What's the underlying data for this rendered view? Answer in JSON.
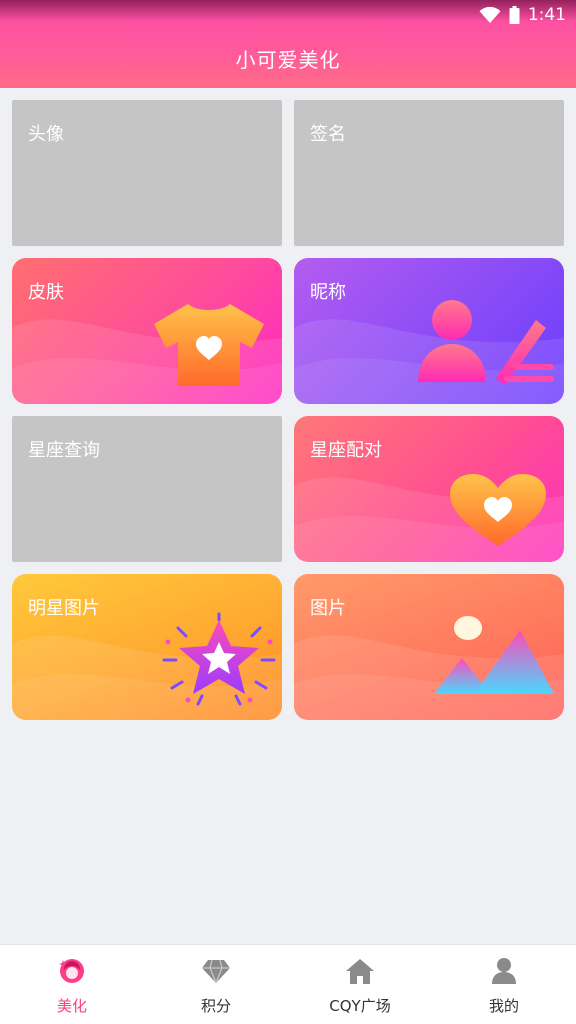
{
  "status_bar": {
    "time": "1:41",
    "wifi_icon": "wifi-icon",
    "battery_icon": "battery-icon"
  },
  "header": {
    "title": "小可爱美化"
  },
  "cards": [
    {
      "label": "头像",
      "style": "flat",
      "icon": null
    },
    {
      "label": "签名",
      "style": "flat",
      "icon": null
    },
    {
      "label": "皮肤",
      "style": "gradient",
      "colors": [
        "#ff6f6f",
        "#ff26c4"
      ],
      "icon": "tshirt-heart-icon"
    },
    {
      "label": "昵称",
      "style": "gradient",
      "colors": [
        "#b45cf0",
        "#6c3cff"
      ],
      "icon": "user-pen-icon"
    },
    {
      "label": "星座查询",
      "style": "flat",
      "icon": null
    },
    {
      "label": "星座配对",
      "style": "gradient",
      "colors": [
        "#ff7878",
        "#ff2fbf"
      ],
      "icon": "heart-icon"
    },
    {
      "label": "明星图片",
      "style": "gradient",
      "colors": [
        "#ffc93a",
        "#ff8620"
      ],
      "icon": "star-burst-icon"
    },
    {
      "label": "图片",
      "style": "gradient",
      "colors": [
        "#ff9a6a",
        "#ff5f5a"
      ],
      "icon": "landscape-icon"
    }
  ],
  "tabbar": {
    "active_color": "#ff3d8a",
    "items": [
      {
        "label": "美化",
        "icon": "girl-face-icon",
        "active": true
      },
      {
        "label": "积分",
        "icon": "diamond-icon",
        "active": false
      },
      {
        "label": "CQY广场",
        "icon": "home-icon",
        "active": false
      },
      {
        "label": "我的",
        "icon": "person-icon",
        "active": false
      }
    ]
  }
}
